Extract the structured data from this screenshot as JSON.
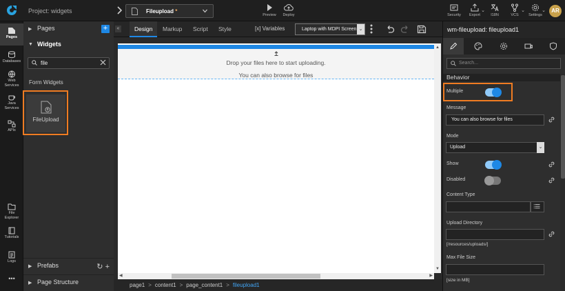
{
  "topbar": {
    "project_label": "Project: widgets",
    "page_name": "Fileupload",
    "page_modified": " *",
    "buttons": [
      {
        "label": "Preview",
        "icon": "play-icon"
      },
      {
        "label": "Deploy",
        "icon": "cloud-upload-icon"
      },
      {
        "label": "Security",
        "icon": "security-icon"
      },
      {
        "label": "Export",
        "icon": "export-icon"
      },
      {
        "label": "I18N",
        "icon": "translate-icon"
      },
      {
        "label": "VCS",
        "icon": "vcs-icon"
      },
      {
        "label": "Settings",
        "icon": "gear-icon"
      }
    ],
    "avatar_initials": "AR"
  },
  "rail": {
    "items": [
      {
        "label": "Pages",
        "icon": "pages-icon"
      },
      {
        "label": "Databases",
        "icon": "database-icon"
      },
      {
        "label": "Web Services",
        "icon": "globe-icon"
      },
      {
        "label": "Java Services",
        "icon": "coffee-icon"
      },
      {
        "label": "APIs",
        "icon": "api-icon"
      },
      {
        "label": "File Explorer",
        "icon": "folder-icon"
      },
      {
        "label": "Tutorials",
        "icon": "book-icon"
      },
      {
        "label": "Logs",
        "icon": "logs-icon"
      },
      {
        "label": "•••",
        "icon": "more-icon"
      }
    ]
  },
  "panel": {
    "pages_label": "Pages",
    "widgets_label": "Widgets",
    "search_value": "file",
    "group_label": "Form Widgets",
    "widget_label": "FileUpload",
    "prefabs_label": "Prefabs",
    "page_structure_label": "Page Structure"
  },
  "center": {
    "tabs": [
      "Design",
      "Markup",
      "Script",
      "Style"
    ],
    "active_tab": "Design",
    "variables_label": "[x] Variables",
    "device_value": "Laptop with MDPI Screen",
    "drop_text": "Drop your files here to start uploading.",
    "browse_text": "You can also browse for files",
    "breadcrumb": [
      "page1",
      "content1",
      "page_content1",
      "fileupload1"
    ]
  },
  "rpanel": {
    "title": "wm-fileupload: fileupload1",
    "search_placeholder": "Search...",
    "section": "Behavior",
    "multiple_label": "Multiple",
    "multiple_on": true,
    "message_label": "Message",
    "message_value": "You can also browse for files",
    "mode_label": "Mode",
    "mode_value": "Upload",
    "show_label": "Show",
    "show_on": true,
    "disabled_label": "Disabled",
    "disabled_on": false,
    "content_type_label": "Content Type",
    "content_type_value": "",
    "upload_dir_label": "Upload Directory",
    "upload_dir_value": "",
    "upload_dir_hint": "[/resources/uploads/]",
    "max_size_label": "Max File Size",
    "max_size_value": "",
    "max_size_hint": "[size in MB]"
  },
  "colors": {
    "accent": "#1e88e5",
    "highlight": "#f07c22",
    "modified": "#e6a25a"
  }
}
